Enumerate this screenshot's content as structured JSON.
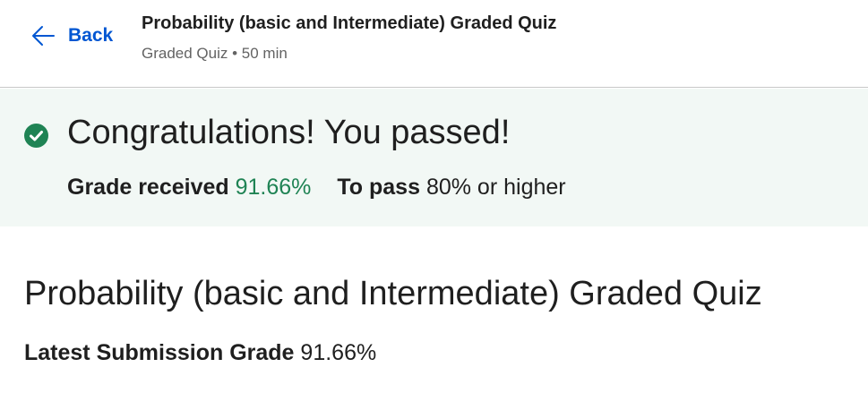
{
  "header": {
    "back_label": "Back",
    "title": "Probability (basic and Intermediate) Graded Quiz",
    "meta": "Graded Quiz • 50 min"
  },
  "banner": {
    "title": "Congratulations! You passed!",
    "grade_label": "Grade received",
    "grade_value": "91.66%",
    "pass_label": "To pass",
    "pass_value": "80% or higher",
    "icon": "check-circle-icon",
    "accent_color": "#1f8354"
  },
  "main": {
    "title": "Probability (basic and Intermediate) Graded Quiz",
    "submission_label": "Latest Submission Grade",
    "submission_value": "91.66%"
  },
  "colors": {
    "link": "#0056d2",
    "success": "#1f8354",
    "banner_bg": "#f2f8f5"
  }
}
